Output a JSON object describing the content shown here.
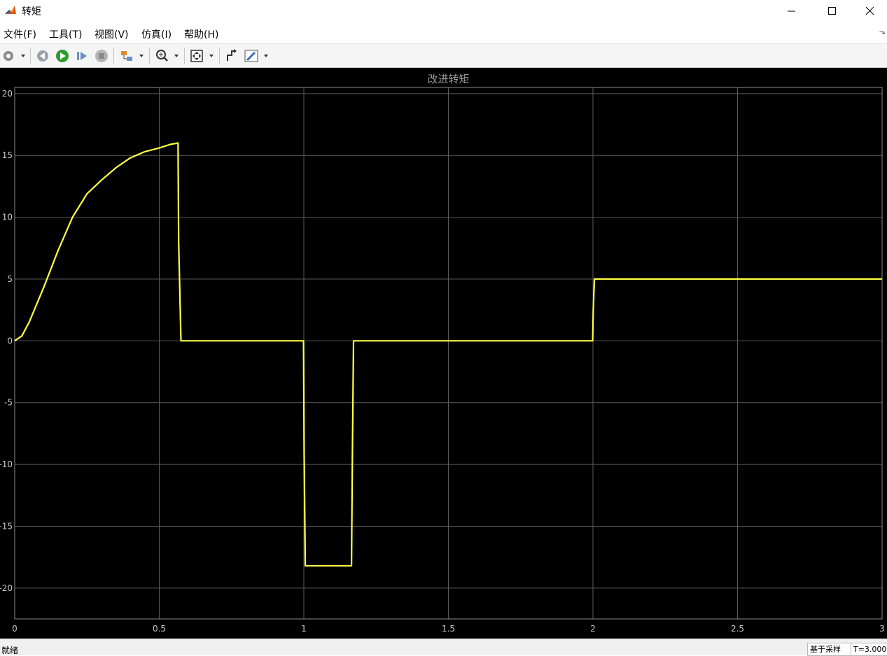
{
  "window": {
    "title": "转矩"
  },
  "menu": [
    "文件(F)",
    "工具(T)",
    "视图(V)",
    "仿真(I)",
    "帮助(H)"
  ],
  "toolbar": {
    "icons": [
      "gear-icon",
      "step-back-icon",
      "run-icon",
      "step-forward-icon",
      "stop-icon",
      "highlight-model-icon",
      "zoom-icon",
      "autoscale-icon",
      "restore-view-icon",
      "style-icon"
    ]
  },
  "status": {
    "left": "就绪",
    "mode": "基于采样",
    "time": "T=3.000"
  },
  "colors": {
    "background": "#000000",
    "grid": "#5a5a5a",
    "line": "#ffff44",
    "title": "#9a9a9a",
    "tick": "#c8c8c8"
  },
  "chart_data": {
    "type": "line",
    "title": "改进转矩",
    "xlabel": "",
    "ylabel": "",
    "xlim": [
      0,
      3
    ],
    "ylim": [
      -22.5,
      20.5
    ],
    "xticks": [
      0,
      0.5,
      1,
      1.5,
      2,
      2.5,
      3
    ],
    "xtick_labels": [
      "0",
      "0.5",
      "1",
      "1.5",
      "2",
      "2.5",
      "3"
    ],
    "yticks": [
      -20,
      -15,
      -10,
      -5,
      0,
      5,
      10,
      15,
      20
    ],
    "ytick_labels": [
      "-20",
      "-15",
      "-10",
      "-5",
      "0",
      "5",
      "10",
      "15",
      "20"
    ],
    "grid": true,
    "series": [
      {
        "x": [
          0,
          0.025,
          0.05,
          0.1,
          0.15,
          0.2,
          0.25,
          0.3,
          0.35,
          0.4,
          0.45,
          0.5,
          0.54,
          0.565,
          0.567,
          0.575,
          0.6,
          0.7,
          0.8,
          0.9,
          0.999,
          1.001,
          1.005,
          1.1,
          1.165,
          1.168,
          1.172,
          1.3,
          1.5,
          1.7,
          1.9,
          1.999,
          2.001,
          2.005,
          2.3,
          2.6,
          3.0
        ],
        "y": [
          0,
          0.4,
          1.5,
          4.3,
          7.3,
          10.0,
          11.9,
          13.0,
          14.0,
          14.8,
          15.3,
          15.6,
          15.9,
          16.0,
          8.0,
          0,
          0,
          0,
          0,
          0,
          0,
          -9.0,
          -18.2,
          -18.2,
          -18.2,
          -9.0,
          0,
          0,
          0,
          0,
          0,
          0,
          2.5,
          5.0,
          5.0,
          5.0,
          5.0
        ]
      }
    ]
  }
}
